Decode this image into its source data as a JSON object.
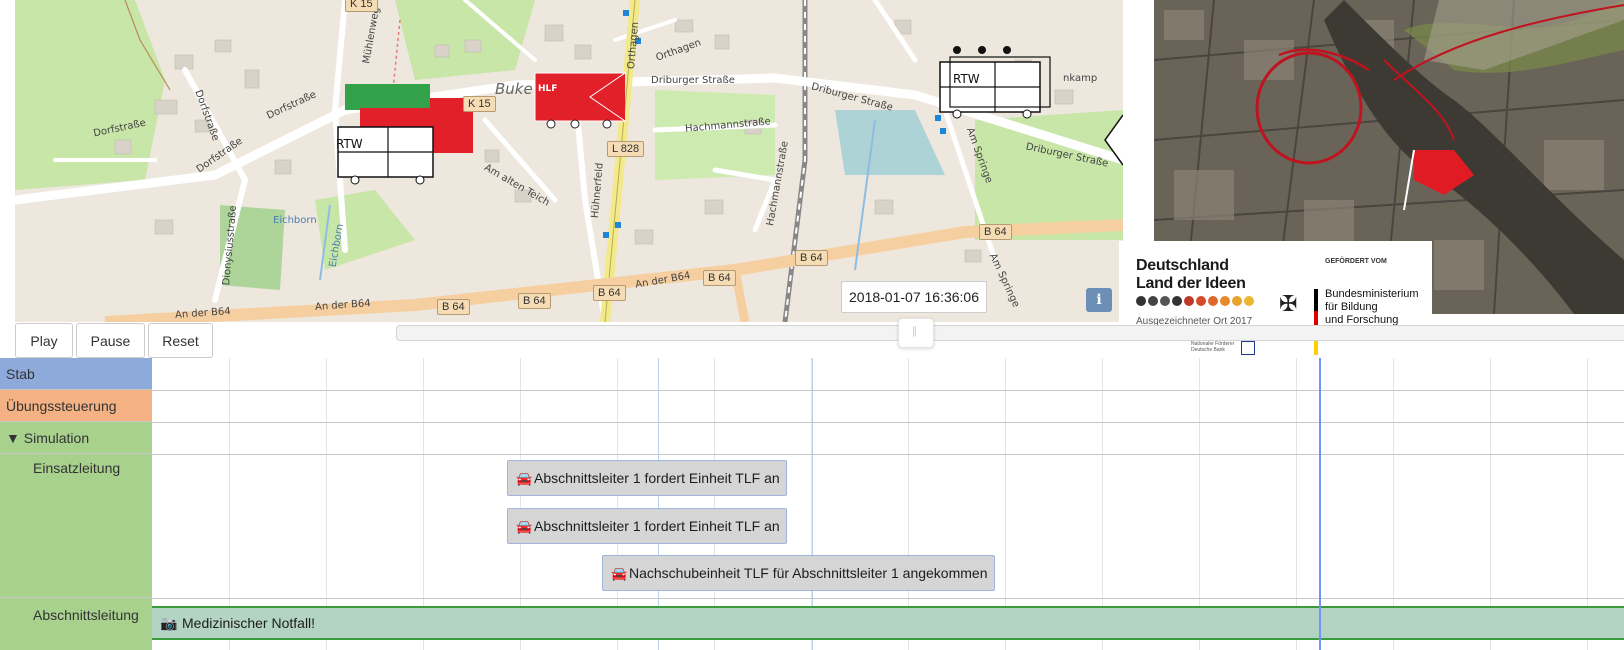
{
  "map": {
    "place_labels": [
      "Dorfstraße",
      "Dorfstraße",
      "Dorfstraße",
      "Dorfstraße",
      "Mühlenweg",
      "Orthagen",
      "Orthagen",
      "Driburger Straße",
      "Driburger Straße",
      "Driburger Straße",
      "Hachmannstraße",
      "Hachmannstraße",
      "Am alten Teich",
      "Hühnerfeld",
      "Dionysiusstraße",
      "Eichborn",
      "Eichborn",
      "Am Springe",
      "Am Springe",
      "An der B64",
      "An der B64",
      "An der B64",
      "Buke",
      "nkamp"
    ],
    "road_shields": [
      "K 15",
      "K 15",
      "L 828",
      "B 64",
      "B 64",
      "B 64",
      "B 64",
      "B 64",
      "B 64"
    ],
    "vehicles": [
      "RTW",
      "HLF",
      "RTW"
    ],
    "timestamp": "2018-01-07 16:36:06",
    "info_button": "i"
  },
  "logo": {
    "title_line1": "Deutschland",
    "title_line2": "Land der Ideen",
    "subtitle": "Ausgezeichneter Ort 2017",
    "sponsor_small": "Nationaler Förderer Deutsche Bank",
    "gefoerdert": "GEFÖRDERT VOM",
    "ministry_line1": "Bundesministerium",
    "ministry_line2": "für Bildung",
    "ministry_line3": "und Forschung",
    "dot_colors": [
      "#333333",
      "#444444",
      "#555555",
      "#333333",
      "#c0392b",
      "#d64a2b",
      "#e0662b",
      "#e88a2b",
      "#e8a12b",
      "#ebb72e"
    ],
    "flag_colors": [
      "#000000",
      "#dd0000",
      "#ffce00"
    ]
  },
  "controls": {
    "play": "Play",
    "pause": "Pause",
    "reset": "Reset"
  },
  "timeline": {
    "groups": [
      {
        "label": "Stab",
        "color": "#8eaadb"
      },
      {
        "label": "Übungssteuerung",
        "color": "#f4b183"
      },
      {
        "label": "▼ Simulation",
        "color": "#a9d18e"
      },
      {
        "label": "Einsatzleitung",
        "color": "#a9d18e"
      },
      {
        "label": "Abschnittsleitung",
        "color": "#a9d18e"
      }
    ],
    "items": [
      {
        "icon": "car-icon",
        "text": "Abschnittsleiter 1 fordert Einheit TLF an"
      },
      {
        "icon": "car-icon",
        "text": "Abschnittsleiter 1 fordert Einheit TLF an"
      },
      {
        "icon": "car-icon",
        "text": "Nachschubeinheit TLF für Abschnittsleiter 1 angekommen"
      }
    ],
    "range_item": {
      "icon": "camera-icon",
      "text": "Medizinischer Notfall!"
    },
    "now_line_color": "#6f93ff"
  }
}
